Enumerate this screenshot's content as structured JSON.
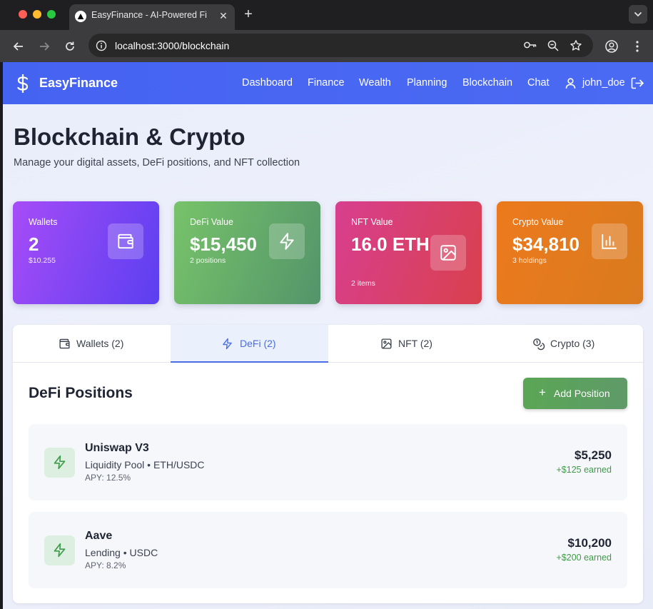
{
  "browser": {
    "tab_title": "EasyFinance - AI-Powered Fi",
    "close_glyph": "✕",
    "new_tab_glyph": "+",
    "url": "localhost:3000/blockchain"
  },
  "nav": {
    "brand": "EasyFinance",
    "brand_icon": "dollar-icon",
    "links": [
      "Dashboard",
      "Finance",
      "Wealth",
      "Planning",
      "Blockchain",
      "Chat"
    ],
    "user": "john_doe"
  },
  "page": {
    "title": "Blockchain & Crypto",
    "subtitle": "Manage your digital assets, DeFi positions, and NFT collection"
  },
  "stats": [
    {
      "label": "Wallets",
      "value": "2",
      "sub": "$10.255",
      "icon": "wallet-icon",
      "gradient": [
        "#a64cf7",
        "#5b3ff0"
      ]
    },
    {
      "label": "DeFi Value",
      "value": "$15,450",
      "sub": "2 positions",
      "icon": "lightning-icon",
      "gradient": [
        "#77c36a",
        "#54946a"
      ]
    },
    {
      "label": "NFT Value",
      "value": "16.0 ETH",
      "sub": "2 items",
      "icon": "image-icon",
      "gradient": [
        "#d83f8f",
        "#d9404d"
      ]
    },
    {
      "label": "Crypto Value",
      "value": "$34,810",
      "sub": "3 holdings",
      "icon": "bar-chart-icon",
      "gradient": [
        "#ec7a1d",
        "#da7a1e"
      ]
    }
  ],
  "tabs": [
    {
      "label": "Wallets (2)",
      "icon": "wallet-icon",
      "active": false
    },
    {
      "label": "DeFi (2)",
      "icon": "lightning-icon",
      "active": true
    },
    {
      "label": "NFT (2)",
      "icon": "image-icon",
      "active": false
    },
    {
      "label": "Crypto (3)",
      "icon": "coins-icon",
      "active": false
    }
  ],
  "defi": {
    "title": "DeFi Positions",
    "add_plus": "+",
    "add_label": "Add Position",
    "positions": [
      {
        "name": "Uniswap V3",
        "type": "Liquidity Pool • ETH/USDC",
        "apy": "APY: 12.5%",
        "value": "$5,250",
        "earned": "+$125 earned"
      },
      {
        "name": "Aave",
        "type": "Lending • USDC",
        "apy": "APY: 8.2%",
        "value": "$10,200",
        "earned": "+$200 earned"
      }
    ]
  },
  "colors": {
    "nav": "#4b6af3",
    "accent": "#4a6de5",
    "success": "#3f9a4a"
  }
}
